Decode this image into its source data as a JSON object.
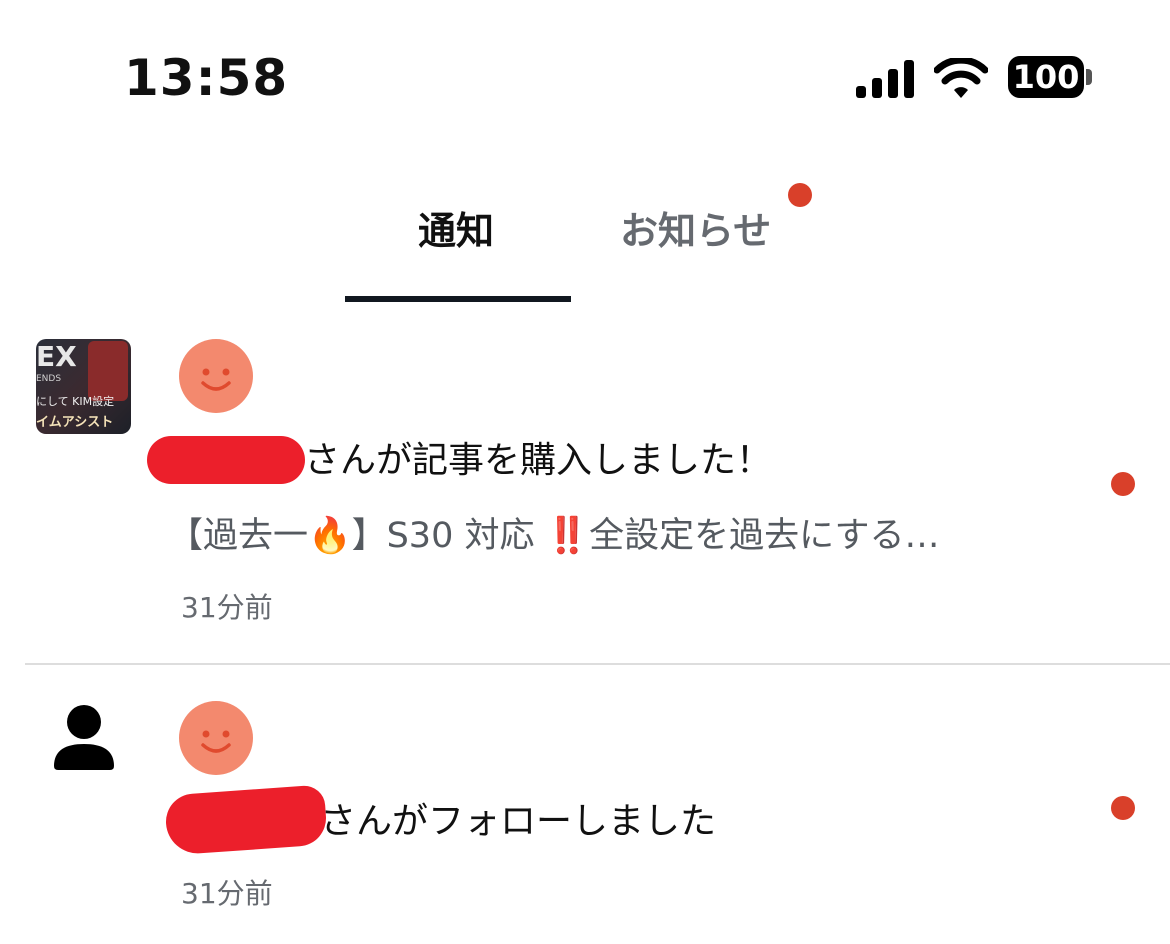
{
  "status_bar": {
    "time": "13:58",
    "battery": "100",
    "icons": [
      "signal-icon",
      "wifi-icon",
      "battery-icon"
    ]
  },
  "tabs": {
    "items": [
      {
        "label": "通知",
        "active": true
      },
      {
        "label": "お知らせ",
        "active": false,
        "has_badge": true
      }
    ]
  },
  "notifications": [
    {
      "thumbnail_icon": "article-thumbnail",
      "thumbnail_text": [
        "EX",
        "ENDS",
        "にして KIM設定",
        "イムアシスト"
      ],
      "avatar_icon": "smiley-avatar-icon",
      "message": "さんが記事を購入しました！",
      "subtitle": "【過去一🔥】S30 対応 ‼️全設定を過去にする…",
      "time": "31分前",
      "unread": true
    },
    {
      "thumbnail_icon": "person-icon",
      "avatar_icon": "smiley-avatar-icon",
      "message": "さんがフォローしました",
      "time": "31分前",
      "unread": true
    }
  ],
  "colors": {
    "badge_red": "#d9402a",
    "redaction_red": "#ec1f2b",
    "avatar_salmon": "#f3896e",
    "indicator": "#111820"
  }
}
